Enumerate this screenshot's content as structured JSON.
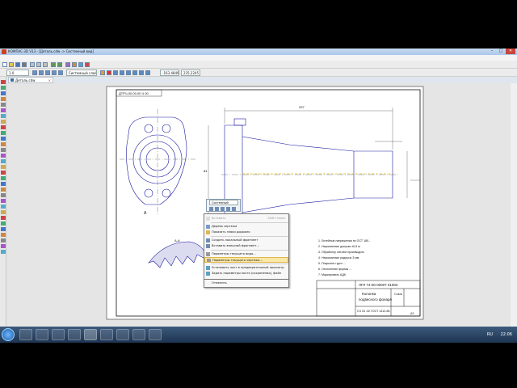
{
  "window": {
    "title": "КОМПАС-3D V13 - [Деталь.cdw -> Системный вид]",
    "minimize": "–",
    "maximize": "□",
    "close": "✕"
  },
  "menu": [
    "Файл",
    "Редактор",
    "Выделить",
    "Вид",
    "Вставка",
    "Инструменты",
    "Спецификация",
    "Сервис",
    "Окно",
    "Справка",
    "Библиотеки"
  ],
  "toolbar": {
    "scale_value": "1.0",
    "layer_value": "Системный слой (0)",
    "zoom_value": "0.5106",
    "coord_x": "-163.4849",
    "coord_y": "235.2245"
  },
  "tab": {
    "label": "Деталь.cdw",
    "close": "×"
  },
  "minibar": {
    "label": "Системный"
  },
  "context_menu": {
    "items": [
      {
        "label": "Вставить",
        "shortcut": "Shift+Insert",
        "disabled": true
      },
      {
        "label": "Дерево чертежа",
        "disabled": false
      },
      {
        "label": "Показать знаки дорожек",
        "disabled": false
      },
      {
        "label": "Создать локальный фрагмент",
        "disabled": false
      },
      {
        "label": "Вставить внешний фрагмент...",
        "disabled": false
      },
      {
        "label": "Параметры текущего вида...",
        "disabled": false
      },
      {
        "label": "Параметры текущего чертежа...",
        "disabled": false,
        "highlight": true
      },
      {
        "label": "Установить лист в предварительный просмотр",
        "disabled": false
      },
      {
        "label": "Задать параметры листа (сохранения), файл",
        "disabled": false
      },
      {
        "label": "Отменить",
        "disabled": false
      }
    ]
  },
  "drawing": {
    "stamp_rotated": "ДТРЧ-00.00.00 Ч 00",
    "title_code": "ЛГЛ 74-00 00007 01002",
    "part_name_1": "Колонка",
    "part_name_2": "подвесного фонаря",
    "material": "Сталь",
    "material_code": "СЧ 15 -32 ГОСТ 1412-85",
    "notes": [
      "1. Литейные напряжения по ОСТ 180...",
      "2. Неуказанные допуски ±0,5 м",
      "3. Обработку литьём производить",
      "4. Неуказанные радиусы 3 мм",
      "5. Покрытие грунт ...",
      "6. Отклонение формы ...",
      "7. Маркировать АДК"
    ],
    "section_label": "А-А",
    "view_label": "А",
    "dim_a": "297",
    "dim_b": "84",
    "format": "А3"
  },
  "statusbar": {
    "text": "Параметры системы и текущего документа"
  },
  "taskbar": {
    "lang": "RU",
    "time": "22:06"
  },
  "colors": {
    "drawing_line": "#1a1aa0",
    "dim_line": "#2a2a2a",
    "highlight": "#fbe7a6"
  }
}
